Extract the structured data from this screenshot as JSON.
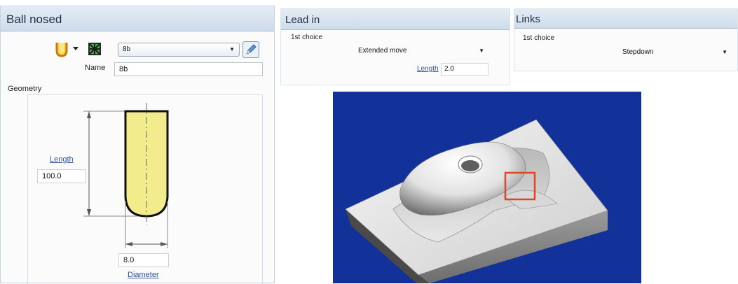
{
  "ball_nosed": {
    "title": "Ball nosed",
    "tool_combo_value": "8b",
    "name_label": "Name",
    "name_value": "8b",
    "geometry_label": "Geometry",
    "length_link": "Length",
    "length_value": "100.0",
    "diameter_value": "8.0",
    "diameter_link": "Diameter"
  },
  "lead_in": {
    "title": "Lead in",
    "choice_label": "1st choice",
    "choice_value": "Extended move",
    "length_link": "Length",
    "length_value": "2.0"
  },
  "links": {
    "title": "Links",
    "choice_label": "1st choice",
    "choice_value": "Stepdown"
  },
  "colors": {
    "title_bar": "#cedcea",
    "tool_fill": "#f3ec8c",
    "viewport_bg": "#12329a",
    "highlight": "#e1452c",
    "link": "#2f55a4"
  },
  "icons": [
    "ball-nose-tool-icon",
    "tool-holder-icon",
    "edit-pencil-icon",
    "dropdown-arrow-icon"
  ]
}
